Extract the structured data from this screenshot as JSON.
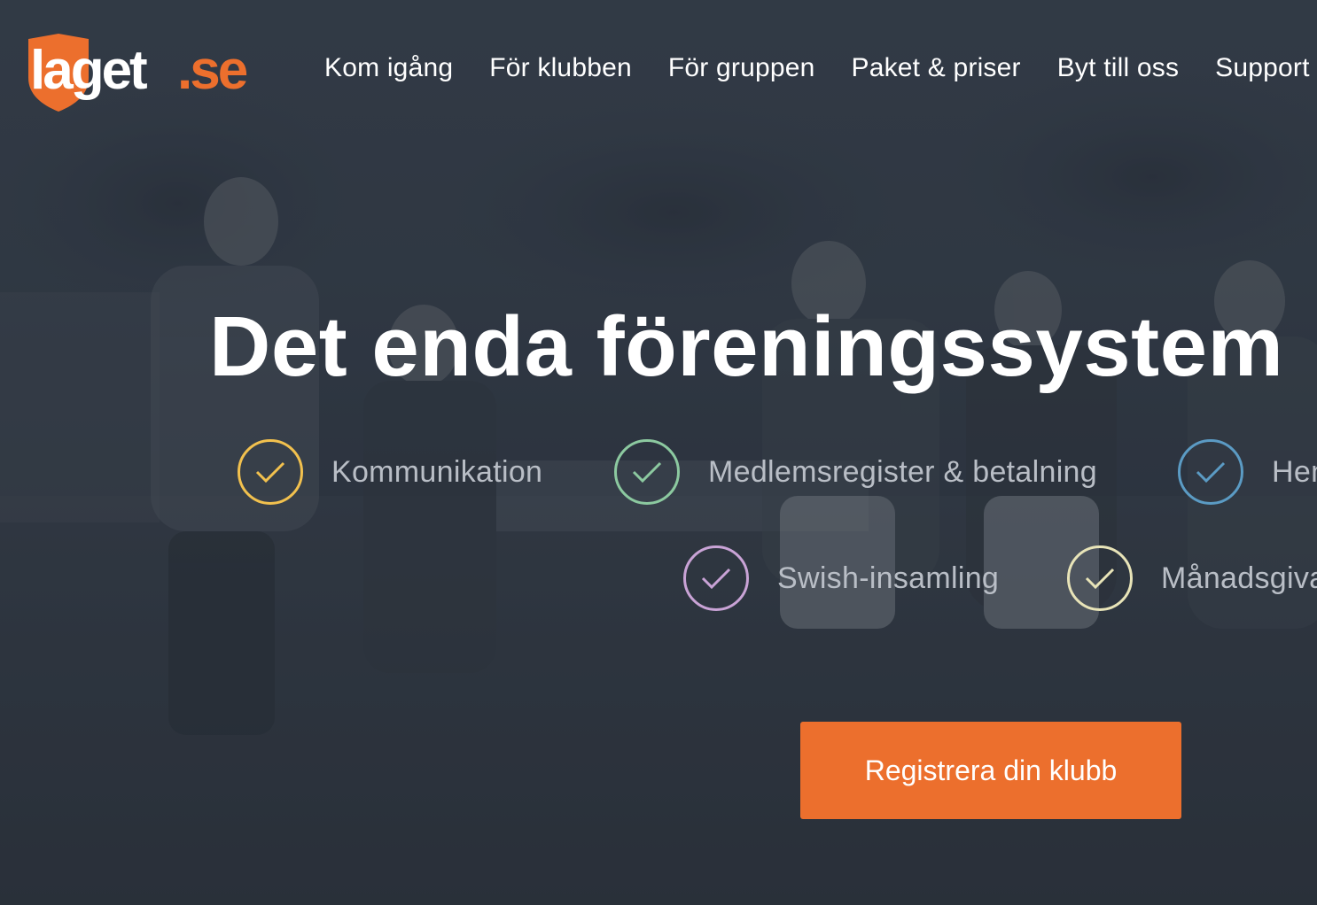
{
  "brand": {
    "logo_text_main": "laget",
    "logo_text_suffix": ".se",
    "accent_color": "#ec6f2d"
  },
  "nav": {
    "items": [
      {
        "label": "Kom igång"
      },
      {
        "label": "För klubben"
      },
      {
        "label": "För gruppen"
      },
      {
        "label": "Paket & priser"
      },
      {
        "label": "Byt till oss"
      },
      {
        "label": "Support"
      }
    ]
  },
  "hero": {
    "headline": "Det enda föreningssystem",
    "features": [
      {
        "label": "Kommunikation",
        "color": "#f2c14e",
        "icon": "check-icon"
      },
      {
        "label": "Medlemsregister & betalning",
        "color": "#8cc9a0",
        "icon": "check-icon"
      },
      {
        "label": "Hemsida",
        "color": "#5b9bc4",
        "icon": "check-icon"
      },
      {
        "label": "Swish-insamling",
        "color": "#c9a3d6",
        "icon": "check-icon"
      },
      {
        "label": "Månadsgivare",
        "color": "#e8e4b8",
        "icon": "check-icon"
      }
    ],
    "cta_label": "Registrera din klubb"
  }
}
